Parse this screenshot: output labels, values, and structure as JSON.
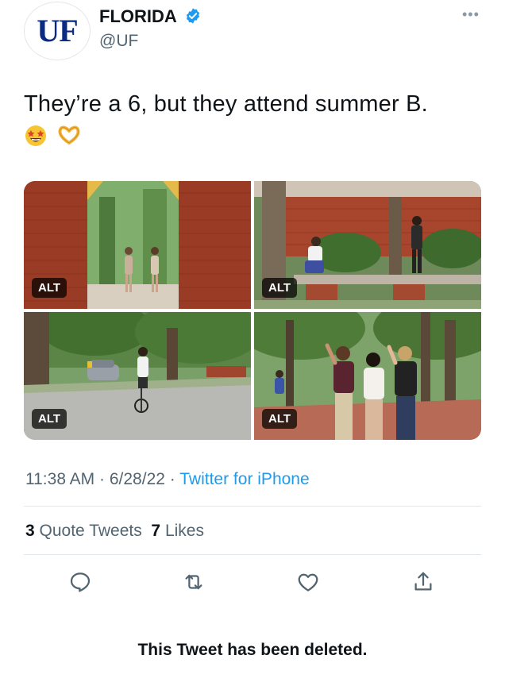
{
  "author": {
    "display_name": "FLORIDA",
    "handle": "@UF",
    "avatar_text": "UF",
    "verified": true
  },
  "tweet": {
    "text": "They’re a 6, but they attend summer B.",
    "emojis": [
      "star-struck-face",
      "heart-hands"
    ],
    "media": [
      {
        "alt_label": "ALT",
        "scene": "two students walking through a brick archway"
      },
      {
        "alt_label": "ALT",
        "scene": "students sitting at a planter ledge under trees"
      },
      {
        "alt_label": "ALT",
        "scene": "cyclist riding down a tree-lined road"
      },
      {
        "alt_label": "ALT",
        "scene": "three students waving on a brick walkway"
      }
    ],
    "time": "11:38 AM",
    "date": "6/28/22",
    "source": "Twitter for iPhone",
    "separator": "·"
  },
  "stats": {
    "quote_count": "3",
    "quote_label": "Quote Tweets",
    "like_count": "7",
    "like_label": "Likes"
  },
  "actions": [
    "reply-icon",
    "retweet-icon",
    "like-icon",
    "share-icon"
  ],
  "footer": {
    "deleted_notice": "This Tweet has been deleted."
  },
  "colors": {
    "link": "#1d9bf0",
    "secondary_text": "#536471",
    "verified": "#1d9bf0",
    "uf_blue": "#0b2a84"
  }
}
